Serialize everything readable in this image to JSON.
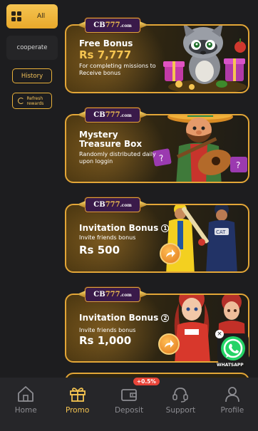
{
  "sidebar": {
    "all_label": "All",
    "cooperate_label": "cooperate",
    "history_label": "History",
    "refresh_label": "Refresh rewards"
  },
  "brand": {
    "logo_main": "CB",
    "logo_num": "777",
    "logo_tld": ".com"
  },
  "cards": [
    {
      "title": "Free Bonus",
      "amount": "Rs 7,777",
      "subtitle": "For completing missions to Receive bonus"
    },
    {
      "title": "Mystery Treasure Box",
      "subtitle": "Randomly distributed daily upon loggin"
    },
    {
      "title": "Invitation Bonus",
      "number": "1",
      "subtitle": "Invite friends bonus",
      "amount": "Rs 500"
    },
    {
      "title": "Invitation Bonus",
      "number": "2",
      "subtitle": "Invite friends bonus",
      "amount": "Rs 1,000"
    }
  ],
  "whatsapp": {
    "label": "WHATSAPP",
    "close": "×"
  },
  "nav": {
    "items": [
      {
        "label": "Home",
        "icon": "home-icon"
      },
      {
        "label": "Promo",
        "icon": "gift-icon",
        "active": true
      },
      {
        "label": "Deposit",
        "icon": "wallet-icon",
        "badge": "+0.5%"
      },
      {
        "label": "Support",
        "icon": "headset-icon"
      },
      {
        "label": "Profile",
        "icon": "user-icon"
      }
    ]
  },
  "colors": {
    "accent": "#f5c451",
    "background": "#1d1d1f",
    "card_border": "#e3a637",
    "badge": "#e8453a",
    "nav_bg": "#262629"
  }
}
